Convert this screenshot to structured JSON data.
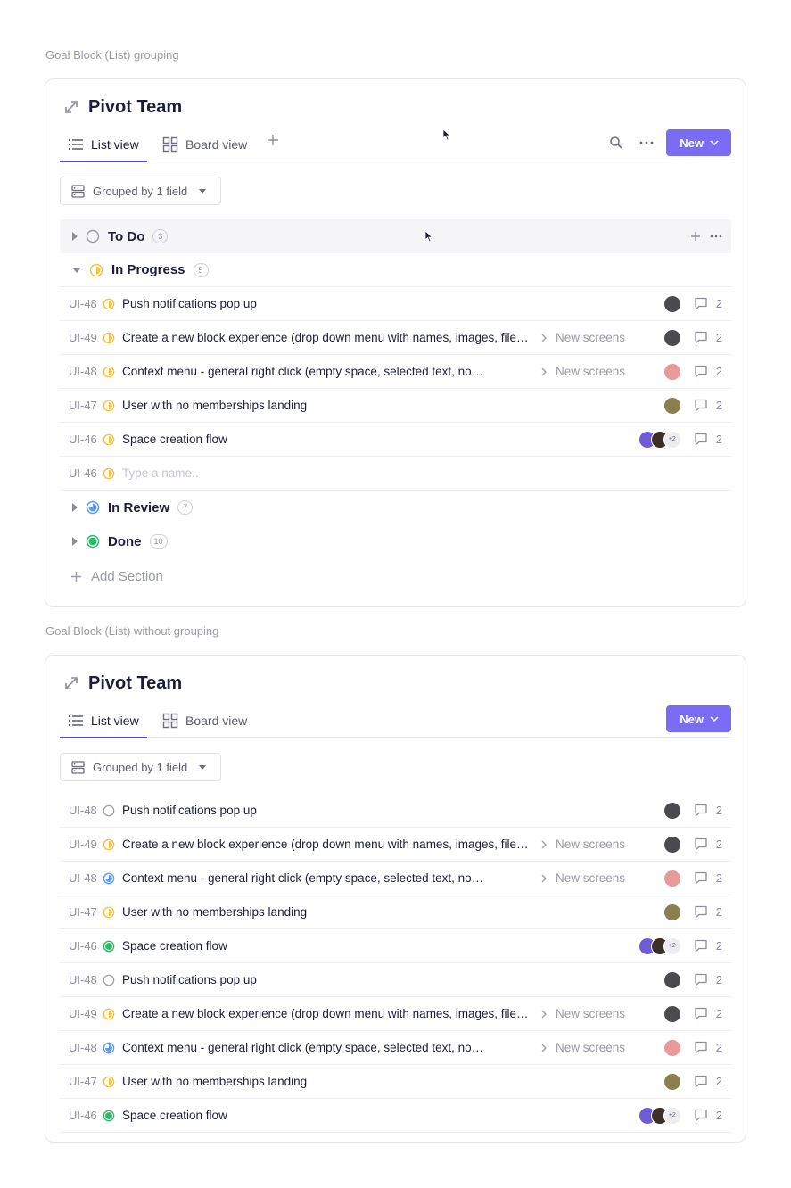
{
  "captions": {
    "grouped": "Goal Block (List) grouping",
    "ungrouped": "Goal Block (List) without grouping"
  },
  "card": {
    "title": "Pivot Team",
    "tab_list": "List view",
    "tab_board": "Board view",
    "new_label": "New",
    "group_label": "Grouped by 1 field"
  },
  "grouped": {
    "todo": {
      "name": "To Do",
      "count": "3"
    },
    "in_progress": {
      "name": "In Progress",
      "count": "5"
    },
    "in_review": {
      "name": "In Review",
      "count": "7"
    },
    "done": {
      "name": "Done",
      "count": "10"
    },
    "tasks": [
      {
        "id": "UI-48",
        "status": "in-progress",
        "name": "Push notifications pop up",
        "crumb": "",
        "comments": "2"
      },
      {
        "id": "UI-49",
        "status": "in-progress",
        "name": "Create a new block experience (drop down menu with names, images, file mentions, etc.)",
        "crumb": "New screens",
        "comments": "2"
      },
      {
        "id": "UI-48",
        "status": "in-progress",
        "name": "Context menu - general right click (empty space, selected text, no…",
        "crumb": "New screens",
        "comments": "2"
      },
      {
        "id": "UI-47",
        "status": "in-progress",
        "name": "User with no memberships landing",
        "crumb": "",
        "comments": "2"
      },
      {
        "id": "UI-46",
        "status": "in-progress",
        "name": "Space creation flow",
        "crumb": "",
        "comments": "2",
        "more": "+2"
      }
    ],
    "new_task": {
      "id": "UI-46",
      "placeholder": "Type a name.."
    },
    "add_section": "Add Section"
  },
  "ungrouped": {
    "tasks": [
      {
        "id": "UI-48",
        "status": "todo",
        "name": "Push notifications pop up",
        "crumb": "",
        "comments": "2"
      },
      {
        "id": "UI-49",
        "status": "in-progress",
        "name": "Create a new block experience (drop down menu with names, images, file mentions, etc.)",
        "crumb": "New screens",
        "comments": "2"
      },
      {
        "id": "UI-48",
        "status": "in-review",
        "name": "Context menu - general right click (empty space, selected text, no…",
        "crumb": "New screens",
        "comments": "2"
      },
      {
        "id": "UI-47",
        "status": "in-progress",
        "name": "User with no memberships landing",
        "crumb": "",
        "comments": "2"
      },
      {
        "id": "UI-46",
        "status": "done",
        "name": "Space creation flow",
        "crumb": "",
        "comments": "2",
        "more": "+2"
      },
      {
        "id": "UI-48",
        "status": "todo",
        "name": "Push notifications pop up",
        "crumb": "",
        "comments": "2"
      },
      {
        "id": "UI-49",
        "status": "in-progress",
        "name": "Create a new block experience (drop down menu with names, images, file mentions, etc.)",
        "crumb": "New screens",
        "comments": "2"
      },
      {
        "id": "UI-48",
        "status": "in-review",
        "name": "Context menu - general right click (empty space, selected text, no…",
        "crumb": "New screens",
        "comments": "2"
      },
      {
        "id": "UI-47",
        "status": "in-progress",
        "name": "User with no memberships landing",
        "crumb": "",
        "comments": "2"
      },
      {
        "id": "UI-46",
        "status": "done",
        "name": "Space creation flow",
        "crumb": "",
        "comments": "2",
        "more": "+2"
      }
    ]
  },
  "colors": {
    "accent": "#7b6cf6",
    "tab_underline": "#4b4bbf",
    "status_in_progress": "#f5c242",
    "status_in_review": "#5b9bf0",
    "status_done": "#2fb86a",
    "status_todo": "#9a9ba8"
  },
  "icons": [
    "expand-icon",
    "list-icon",
    "board-icon",
    "plus-icon",
    "search-icon",
    "more-icon",
    "chevron-down-icon",
    "group-icon",
    "comment-icon",
    "chevron-right-icon"
  ]
}
